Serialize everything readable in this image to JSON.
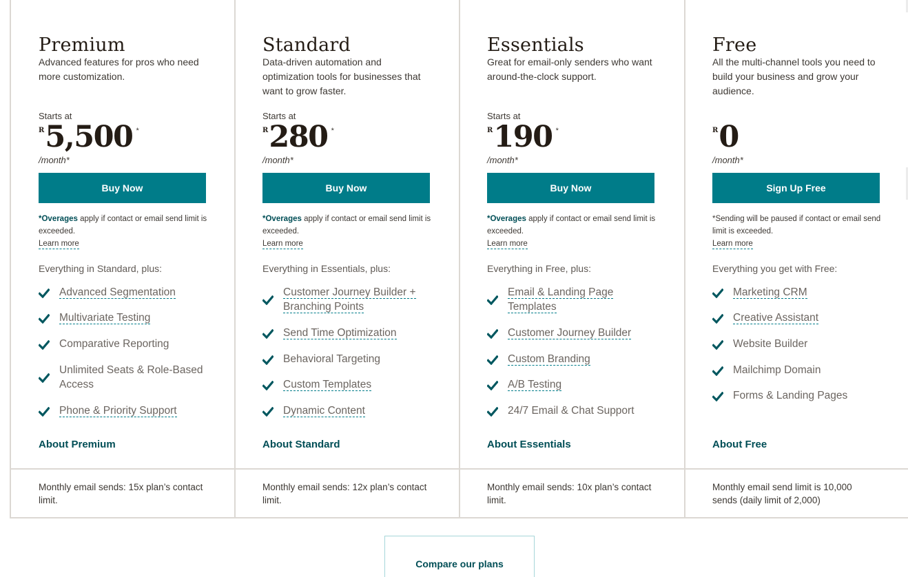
{
  "plans": [
    {
      "name": "Premium",
      "description": "Advanced features for pros who need more customization.",
      "starts_at": "Starts at",
      "currency": "R",
      "price": "5,500",
      "price_asterisk": "*",
      "period": "/month*",
      "cta": "Buy Now",
      "note_bold": "*Overages",
      "note_rest": " apply if contact or email send limit is exceeded.",
      "learn_more": "Learn more",
      "everything": "Everything in Standard, plus:",
      "features": [
        {
          "label": "Advanced Segmentation",
          "link": true
        },
        {
          "label": "Multivariate Testing",
          "link": true
        },
        {
          "label": "Comparative Reporting",
          "link": false
        },
        {
          "label": "Unlimited Seats & Role-Based Access",
          "link": false
        },
        {
          "label": "Phone & Priority Support",
          "link": true
        }
      ],
      "about": "About Premium",
      "send_limit": "Monthly email sends: 15x plan’s contact limit."
    },
    {
      "name": "Standard",
      "description": "Data-driven automation and optimization tools for businesses that want to grow faster.",
      "starts_at": "Starts at",
      "currency": "R",
      "price": "280",
      "price_asterisk": "*",
      "period": "/month*",
      "cta": "Buy Now",
      "note_bold": "*Overages",
      "note_rest": " apply if contact or email send limit is exceeded.",
      "learn_more": "Learn more",
      "everything": "Everything in Essentials, plus:",
      "features": [
        {
          "label": "Customer Journey Builder + Branching Points",
          "link": true
        },
        {
          "label": "Send Time Optimization",
          "link": true
        },
        {
          "label": "Behavioral Targeting",
          "link": false
        },
        {
          "label": "Custom Templates",
          "link": true
        },
        {
          "label": "Dynamic Content",
          "link": true
        }
      ],
      "about": "About Standard",
      "send_limit": "Monthly email sends: 12x plan’s contact limit."
    },
    {
      "name": "Essentials",
      "description": "Great for email-only senders who want around-the-clock support.",
      "starts_at": "Starts at",
      "currency": "R",
      "price": "190",
      "price_asterisk": "*",
      "period": "/month*",
      "cta": "Buy Now",
      "note_bold": "*Overages",
      "note_rest": " apply if contact or email send limit is exceeded.",
      "learn_more": "Learn more",
      "everything": "Everything in Free, plus:",
      "features": [
        {
          "label": "Email & Landing Page Templates",
          "link": true
        },
        {
          "label": "Customer Journey Builder",
          "link": true
        },
        {
          "label": "Custom Branding",
          "link": true
        },
        {
          "label": "A/B Testing",
          "link": true
        },
        {
          "label": "24/7 Email & Chat Support",
          "link": false
        }
      ],
      "about": "About Essentials",
      "send_limit": "Monthly email sends: 10x plan’s contact limit."
    },
    {
      "name": "Free",
      "description": "All the multi-channel tools you need to build your business and grow your audience.",
      "starts_at": "",
      "currency": "R",
      "price": "0",
      "price_asterisk": "",
      "period": "/month*",
      "cta": "Sign Up Free",
      "note_bold": "",
      "note_rest": "*Sending will be paused if contact or email send limit is exceeded.",
      "learn_more": "Learn more",
      "everything": "Everything you get with Free:",
      "features": [
        {
          "label": "Marketing CRM",
          "link": true
        },
        {
          "label": "Creative Assistant",
          "link": true
        },
        {
          "label": "Website Builder",
          "link": false
        },
        {
          "label": "Mailchimp Domain",
          "link": false
        },
        {
          "label": "Forms & Landing Pages",
          "link": false
        }
      ],
      "about": "About Free",
      "send_limit": "Monthly email send limit is 10,000 sends (daily limit of 2,000)"
    }
  ],
  "compare_button": "Compare our plans",
  "colors": {
    "accent": "#007c89",
    "accent_dark": "#004e56",
    "check": "#00575f",
    "border": "#dcd8d3"
  }
}
